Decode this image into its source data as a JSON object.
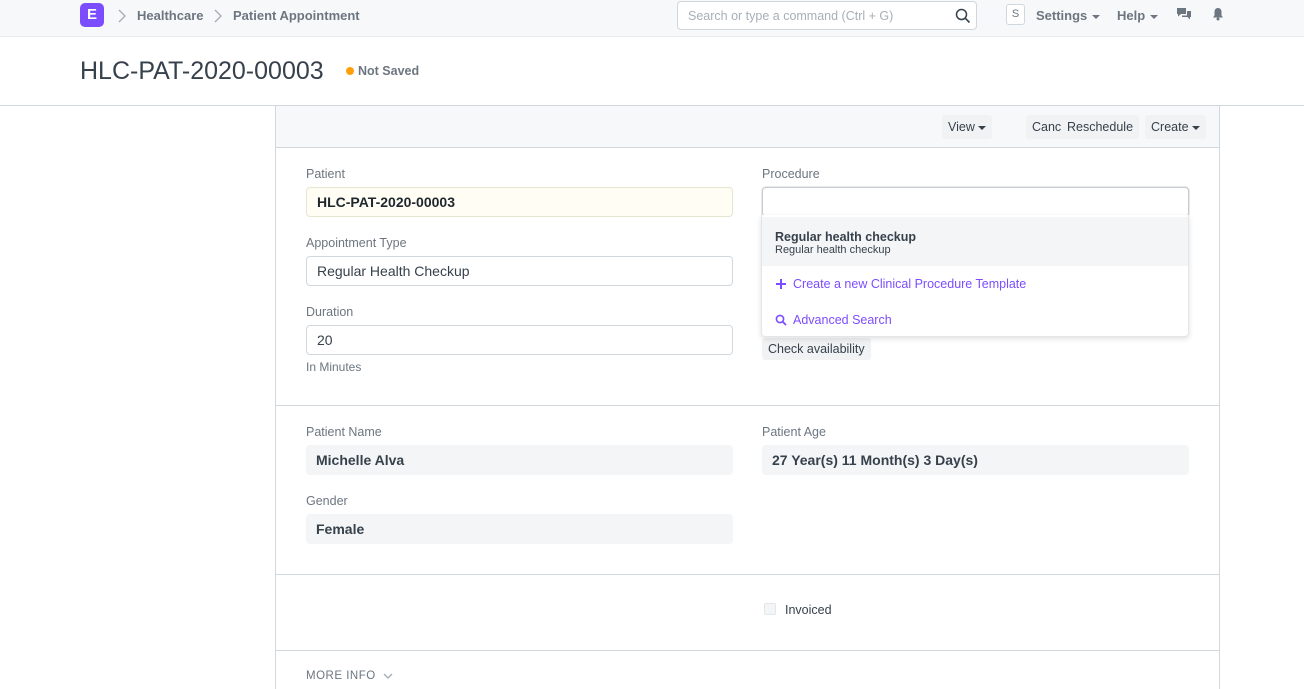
{
  "navbar": {
    "logo_letter": "E",
    "breadcrumbs": [
      "Healthcare",
      "Patient Appointment"
    ],
    "search_placeholder": "Search or type a command (Ctrl + G)",
    "avatar_letter": "S",
    "settings_label": "Settings",
    "help_label": "Help"
  },
  "page": {
    "title": "HLC-PAT-2020-00003",
    "status": "Not Saved",
    "status_color": "#ffa00a"
  },
  "toolbar": {
    "view_label": "View",
    "cancel_label": "Cancel",
    "reschedule_label": "Reschedule",
    "create_label": "Create"
  },
  "form": {
    "patient_label": "Patient",
    "patient_value": "HLC-PAT-2020-00003",
    "appointment_type_label": "Appointment Type",
    "appointment_type_value": "Regular Health Checkup",
    "duration_label": "Duration",
    "duration_value": "20",
    "duration_help": "In Minutes",
    "procedure_label": "Procedure",
    "procedure_value": "",
    "check_availability_label": "Check availability",
    "patient_name_label": "Patient Name",
    "patient_name_value": "Michelle Alva",
    "patient_age_label": "Patient Age",
    "patient_age_value": "27 Year(s) 11 Month(s) 3 Day(s)",
    "gender_label": "Gender",
    "gender_value": "Female",
    "invoiced_label": "Invoiced",
    "more_info_label": "MORE INFO"
  },
  "dropdown": {
    "items": [
      {
        "title": "Regular health checkup",
        "subtitle": "Regular health checkup"
      }
    ],
    "create_new_label": "Create a new Clinical Procedure Template",
    "advanced_search_label": "Advanced Search"
  },
  "colors": {
    "brand": "#7c4dff",
    "link": "#7c4dff"
  }
}
